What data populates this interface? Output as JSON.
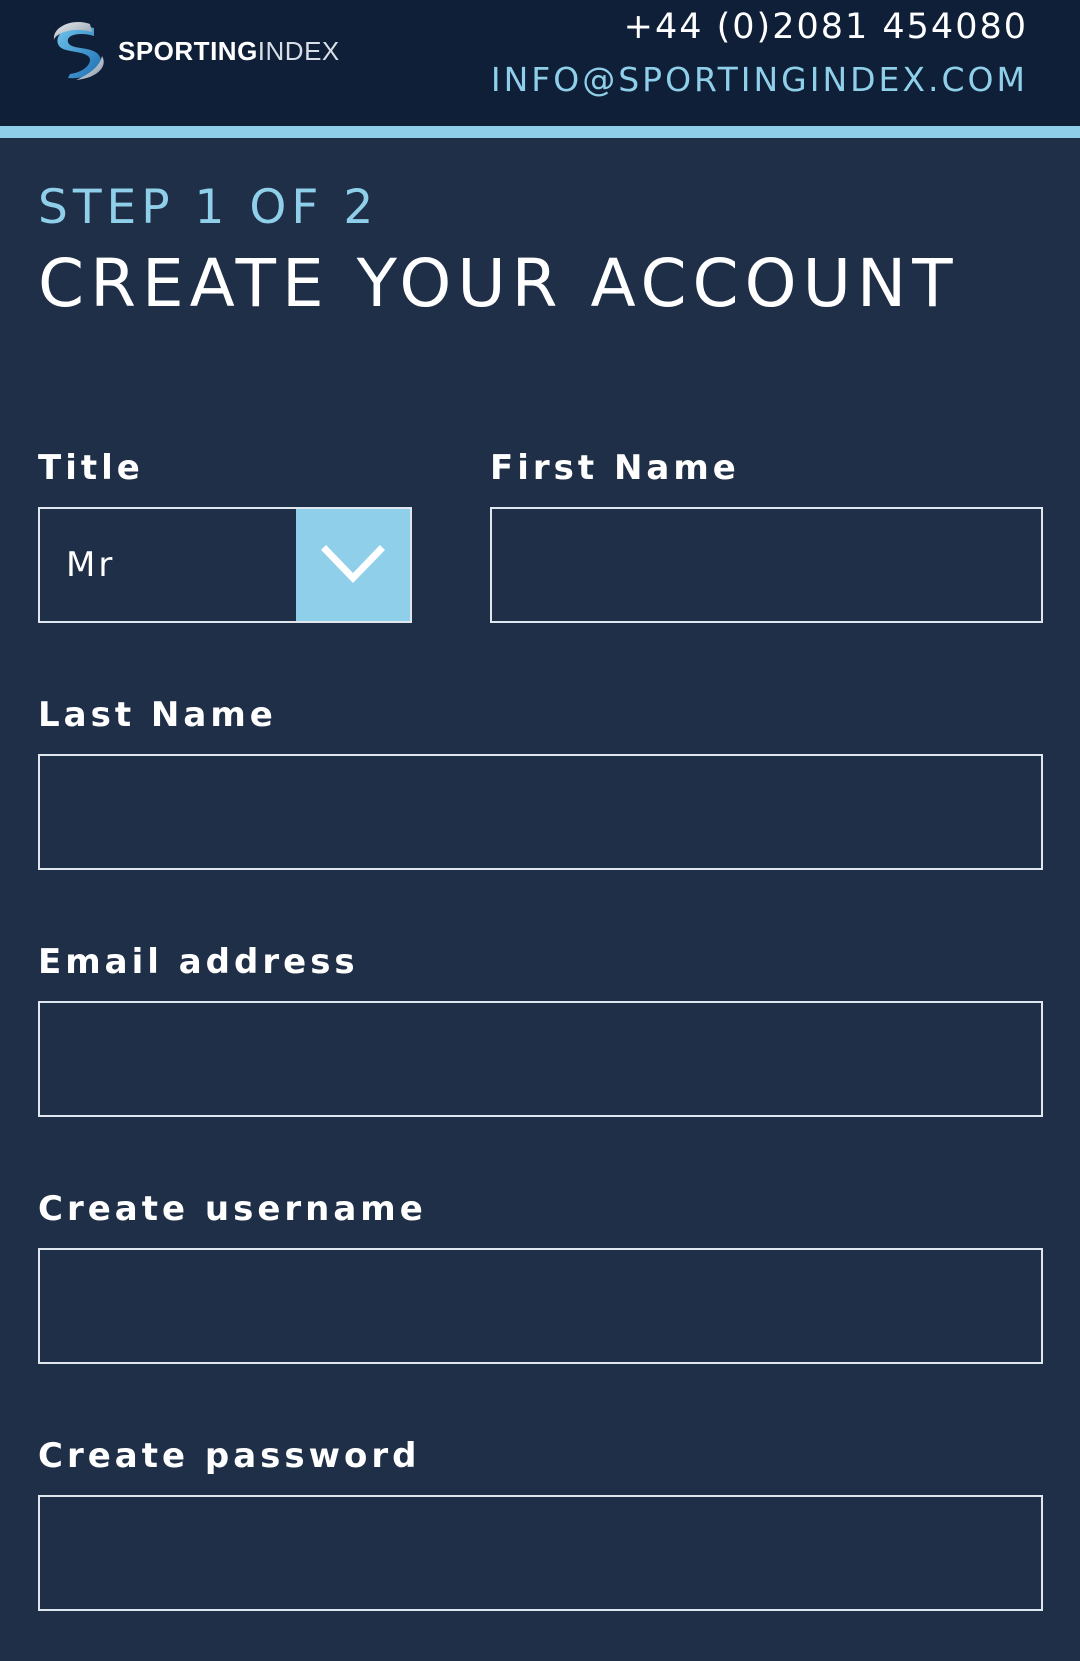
{
  "header": {
    "logo_bold": "SPORTING",
    "logo_light": "INDEX",
    "phone": "+44 (0)2081 454080",
    "email": "INFO@SPORTINGINDEX.COM"
  },
  "form": {
    "step": "STEP 1 OF 2",
    "title": "CREATE YOUR ACCOUNT",
    "fields": {
      "title": {
        "label": "Title",
        "value": "Mr"
      },
      "first_name": {
        "label": "First Name",
        "value": ""
      },
      "last_name": {
        "label": "Last Name",
        "value": ""
      },
      "email": {
        "label": "Email address",
        "value": ""
      },
      "username": {
        "label": "Create username",
        "value": ""
      },
      "password": {
        "label": "Create password",
        "value": ""
      }
    }
  },
  "colors": {
    "background": "#1f2f48",
    "header": "#0f1f38",
    "accent": "#8fcfe9",
    "border": "#dfe6ee"
  },
  "icons": {
    "logo": "sporting-index-swoosh-logo",
    "dropdown": "chevron-down-icon"
  }
}
